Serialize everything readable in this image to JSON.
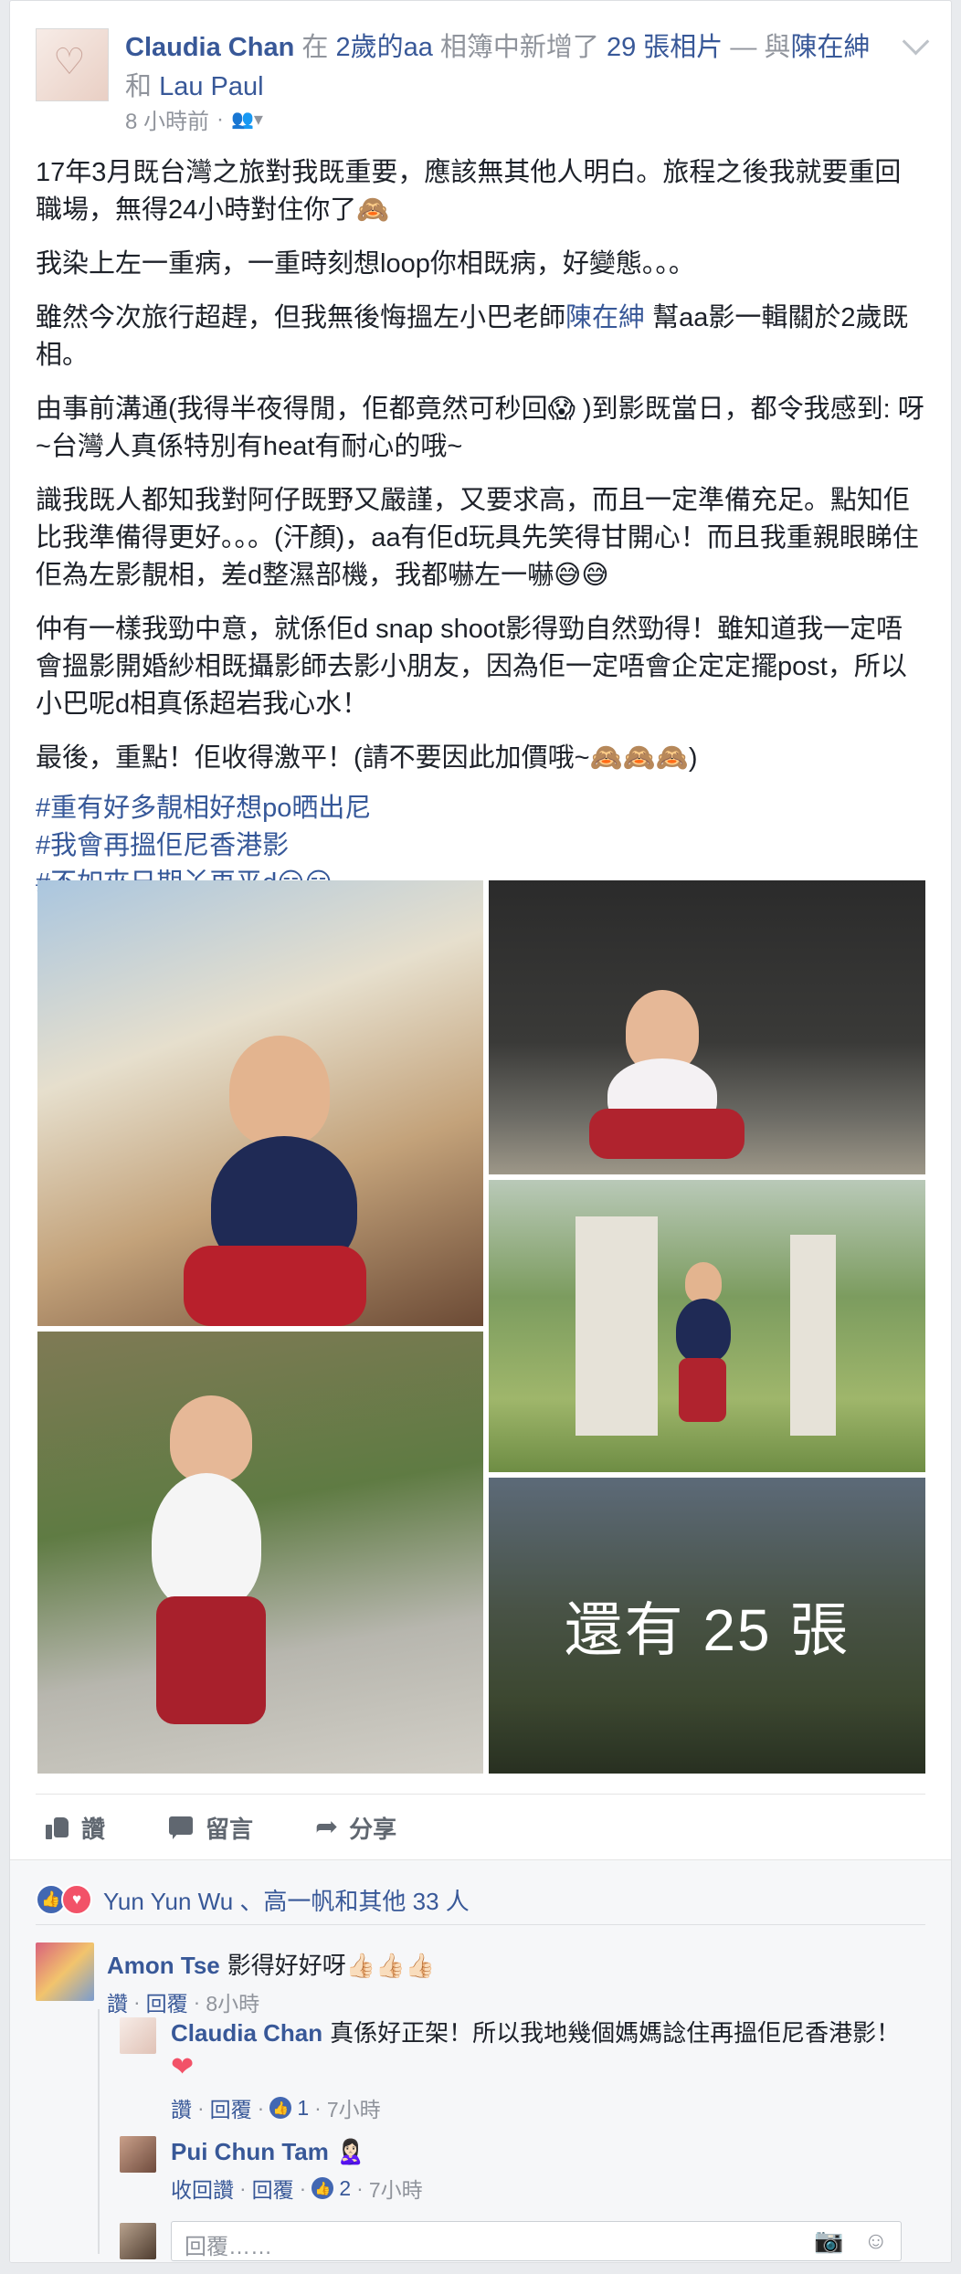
{
  "post": {
    "author": "Claudia Chan",
    "headline_in": "在",
    "album": "2歲的aa",
    "headline_mid": "相簿中新增了",
    "photo_count": "29 張相片",
    "headline_with": "— 與",
    "tag1": "陳在紳",
    "headline_and": "和",
    "tag2": "Lau Paul",
    "time": "8 小時前",
    "privacy": "·",
    "paragraphs": {
      "p1": "17年3月既台灣之旅對我既重要，應該無其他人明白。旅程之後我就要重回職場，無得24小時對住你了🙈",
      "p2": "我染上左一重病，一重時刻想loop你相既病，好變態。。。",
      "p3a": "雖然今次旅行超趕，但我無後悔搵左小巴老師",
      "p3link": "陳在紳",
      "p3b": " 幫aa影一輯關於2歲既相。",
      "p4": "由事前溝通(我得半夜得閒，佢都竟然可秒回😱 )到影既當日，都令我感到: 呀~台灣人真係特別有heat有耐心的哦~",
      "p5": "識我既人都知我對阿仔既野又嚴謹，又要求高，而且一定準備充足。點知佢比我準備得更好。。。(汗顏)，aa有佢d玩具先笑得甘開心！而且我重親眼睇住佢為左影靚相，差d整濕部機，我都嚇左一嚇😅😅",
      "p6": "仲有一樣我勁中意，就係佢d snap shoot影得勁自然勁得！雖知道我一定唔會搵影開婚紗相既攝影師去影小朋友，因為佢一定唔會企定定擺post，所以小巴呢d相真係超岩我心水！",
      "p7": "最後，重點！佢收得激平！(請不要因此加價哦~🙈🙈🙈)"
    },
    "hashtags": [
      "#重有好多靚相好想po晒出尼",
      "#我會再搵佢尼香港影",
      "#不如夾日期丫再平d😏😏"
    ],
    "more_photos": "還有 25 張"
  },
  "actions": {
    "like": "讚",
    "comment": "留言",
    "share": "分享"
  },
  "reactions": {
    "text": "Yun Yun Wu 、高一帆和其他 33 人"
  },
  "comments": [
    {
      "name": "Amon Tse",
      "text": "影得好好呀👍🏻👍🏻👍🏻",
      "like": "讚",
      "reply": "回覆",
      "time": "8小時"
    },
    {
      "name": "Claudia Chan",
      "text": "真係好正架！所以我地幾個媽媽諗住再搵佢尼香港影！",
      "emoji": "❤",
      "like": "讚",
      "reply": "回覆",
      "count": "1",
      "time": "7小時"
    },
    {
      "name": "Pui Chun Tam",
      "text": "🙎🏻‍♀️",
      "like": "收回讚",
      "reply": "回覆",
      "count": "2",
      "time": "7小時"
    }
  ],
  "reply": {
    "placeholder": "回覆……"
  }
}
